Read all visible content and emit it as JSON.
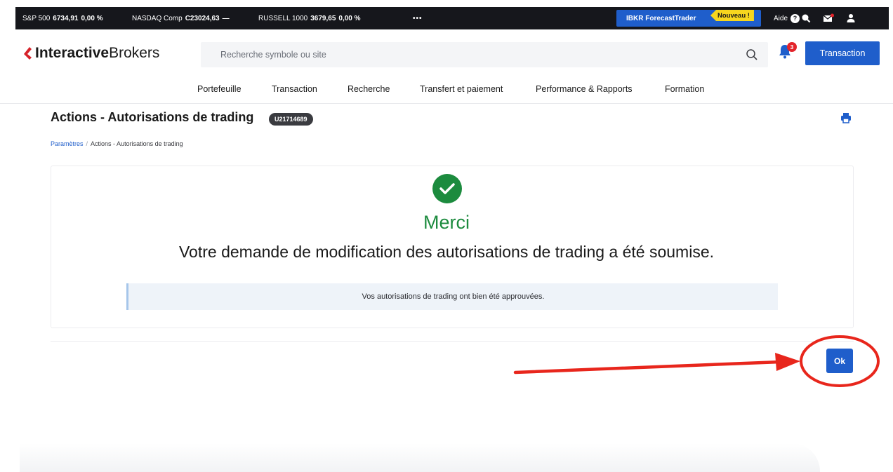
{
  "ticker": {
    "items": [
      {
        "name": "S&P 500",
        "value": "6734,91",
        "change": "0,00 %"
      },
      {
        "name": "NASDAQ Comp",
        "value": "C23024,63",
        "change": "—"
      },
      {
        "name": "RUSSELL 1000",
        "value": "3679,65",
        "change": "0,00 %"
      }
    ],
    "more": "•••",
    "forecast_label": "IBKR ForecastTrader",
    "new_badge": "Nouveau !",
    "help_label": "Aide",
    "help_glyph": "?"
  },
  "header": {
    "logo_bold": "Interactive",
    "logo_rest": "Brokers",
    "search_placeholder": "Recherche symbole ou site",
    "notification_count": "3",
    "trade_button": "Transaction"
  },
  "nav": {
    "items": [
      "Portefeuille",
      "Transaction",
      "Recherche",
      "Transfert et paiement",
      "Performance & Rapports",
      "Formation"
    ]
  },
  "page": {
    "title": "Actions - Autorisations de trading",
    "account_id": "U21714689",
    "breadcrumb_root": "Paramètres",
    "breadcrumb_sep": "/",
    "breadcrumb_current": "Actions - Autorisations de trading"
  },
  "confirmation": {
    "heading": "Merci",
    "message": "Votre demande de modification des autorisations de trading a été soumise.",
    "notice": "Vos autorisations de trading ont bien été approuvées.",
    "ok_button": "Ok"
  },
  "colors": {
    "ticker_bg": "#16171c",
    "brand_blue": "#1f5ecb",
    "success_green": "#1c8b3e",
    "annotation_red": "#e8261c",
    "badge_yellow": "#f7d61e"
  },
  "icons": [
    "search-icon",
    "bell-icon",
    "print-icon",
    "check-icon",
    "help-icon",
    "user-icon",
    "mail-icon",
    "chat-icon",
    "ibkr-logo-icon"
  ]
}
